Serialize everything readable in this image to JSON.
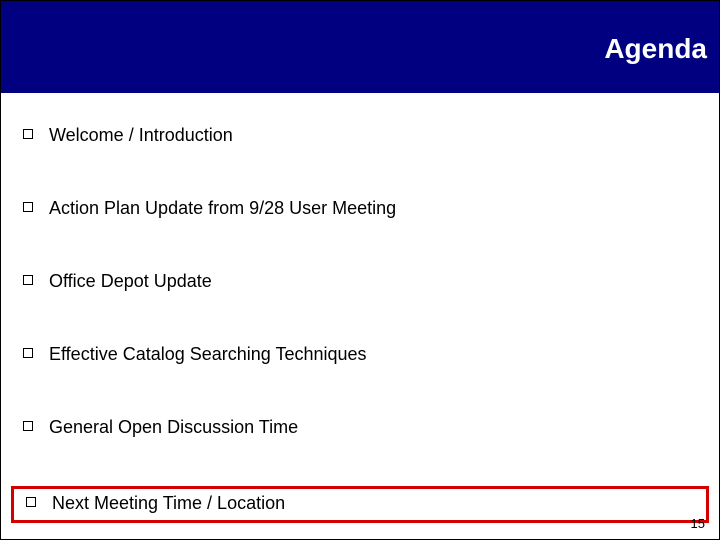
{
  "header": {
    "title": "Agenda"
  },
  "items": [
    {
      "text": "Welcome / Introduction",
      "highlighted": false
    },
    {
      "text": "Action Plan Update from 9/28 User Meeting",
      "highlighted": false
    },
    {
      "text": "Office Depot Update",
      "highlighted": false
    },
    {
      "text": "Effective Catalog Searching Techniques",
      "highlighted": false
    },
    {
      "text": "General Open Discussion Time",
      "highlighted": false
    },
    {
      "text": "Next Meeting Time / Location",
      "highlighted": true
    }
  ],
  "page_number": "15",
  "colors": {
    "header_bg": "#000080",
    "highlight_border": "#d40000"
  }
}
